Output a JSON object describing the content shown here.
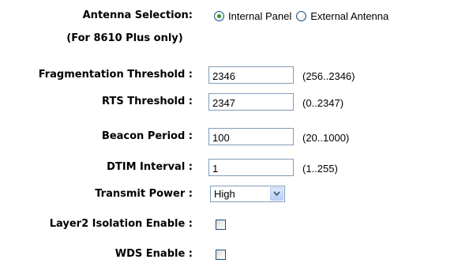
{
  "antenna": {
    "label": "Antenna Selection:",
    "note": "(For 8610 Plus only)",
    "options": [
      {
        "label": "Internal Panel",
        "checked": true
      },
      {
        "label": "External Antenna",
        "checked": false
      }
    ]
  },
  "fields": [
    {
      "label": "Fragmentation Threshold :",
      "value": "2346",
      "range": "(256..2346)"
    },
    {
      "label": "RTS Threshold :",
      "value": "2347",
      "range": "(0..2347)"
    },
    {
      "label": "Beacon Period :",
      "value": "100",
      "range": "(20..1000)"
    },
    {
      "label": "DTIM Interval :",
      "value": "1",
      "range": "(1..255)"
    }
  ],
  "transmit_power": {
    "label": "Transmit Power :",
    "selected": "High"
  },
  "layer2_isolation": {
    "label": "Layer2 Isolation Enable :",
    "checked": false
  },
  "wds": {
    "label": "WDS Enable :",
    "checked": false
  }
}
